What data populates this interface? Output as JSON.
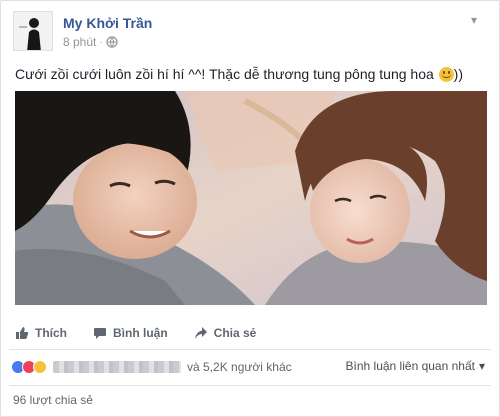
{
  "post": {
    "author": "My Khởi Trần",
    "time": "8 phút",
    "text": "Cưới zồi cưới luôn zồi hí hí ^^! Thặc dễ thương tung pông tung hoa ",
    "text_tail": "))"
  },
  "actions": {
    "like": "Thích",
    "comment": "Bình luận",
    "share": "Chia sẻ"
  },
  "reactions": {
    "others": "và 5,2K người khác",
    "sort_label": "Bình luận liên quan nhất"
  },
  "shares": "96 lượt chia sẻ",
  "colors": {
    "link": "#365899",
    "like_blue": "#4a78f0",
    "love_red": "#f0405a",
    "haha_yellow": "#f5c33b"
  }
}
